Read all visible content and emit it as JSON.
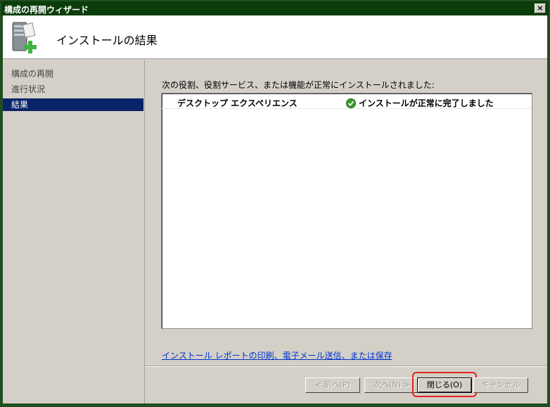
{
  "window": {
    "title": "構成の再開ウィザード",
    "close_glyph": "×"
  },
  "header": {
    "heading": "インストールの結果"
  },
  "nav": {
    "items": [
      {
        "label": "構成の再開",
        "active": false
      },
      {
        "label": "進行状況",
        "active": false
      },
      {
        "label": "結果",
        "active": true
      }
    ]
  },
  "content": {
    "intro": "次の役割、役割サービス、または機能が正常にインストールされました:",
    "results": [
      {
        "feature": "デスクトップ エクスペリエンス",
        "status": "インストールが正常に完了しました"
      }
    ],
    "report_link": "インストール レポートの印刷、電子メール送信、または保存"
  },
  "footer": {
    "back_label": "< 前へ(P)",
    "next_label": "次へ(N) >",
    "close_label": "閉じる(O)",
    "cancel_label": "キャンセル"
  },
  "colors": {
    "selection": "#0a246a",
    "highlight": "#e0261c",
    "success": "#3a9a2a"
  }
}
